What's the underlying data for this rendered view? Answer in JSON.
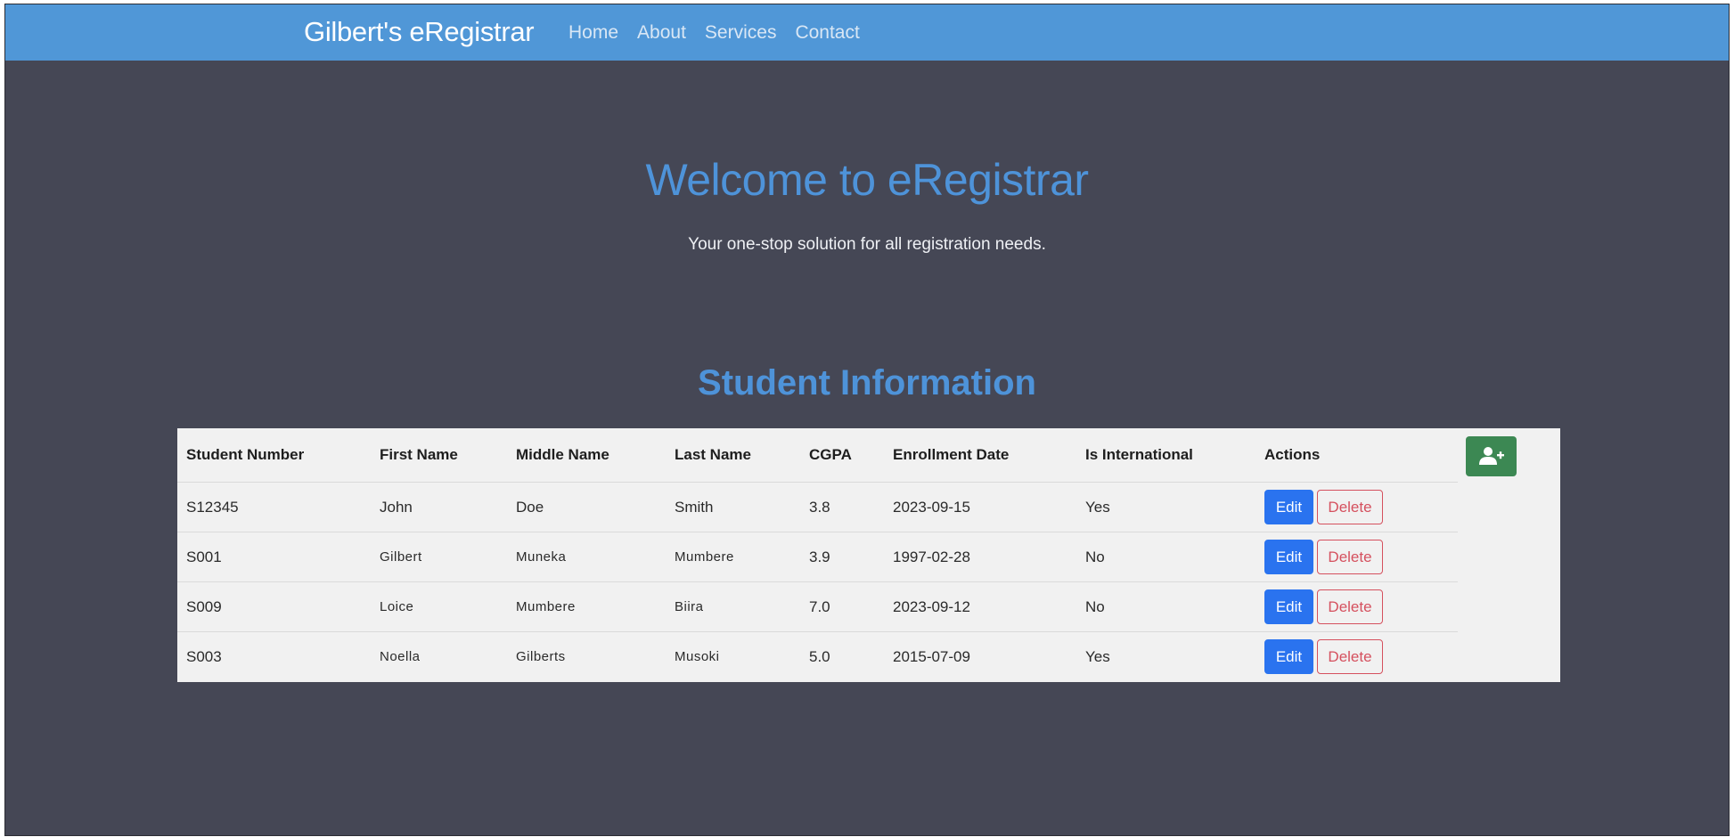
{
  "navbar": {
    "brand": "Gilbert's eRegistrar",
    "links": [
      {
        "label": "Home"
      },
      {
        "label": "About"
      },
      {
        "label": "Services"
      },
      {
        "label": "Contact"
      }
    ]
  },
  "hero": {
    "title": "Welcome to eRegistrar",
    "subtitle": "Your one-stop solution for all registration needs."
  },
  "students": {
    "section_title": "Student Information",
    "columns": [
      "Student Number",
      "First Name",
      "Middle Name",
      "Last Name",
      "CGPA",
      "Enrollment Date",
      "Is International",
      "Actions"
    ],
    "add_button_icon": "user-plus-icon",
    "rows": [
      {
        "number": "S12345",
        "first": "John",
        "middle": "Doe",
        "last": "Smith",
        "cgpa": "3.8",
        "date": "2023-09-15",
        "intl": "Yes"
      },
      {
        "number": "S001",
        "first": "Gilbert",
        "middle": "Muneka",
        "last": "Mumbere",
        "cgpa": "3.9",
        "date": "1997-02-28",
        "intl": "No"
      },
      {
        "number": "S009",
        "first": "Loice",
        "middle": "Mumbere",
        "last": "Biira",
        "cgpa": "7.0",
        "date": "2023-09-12",
        "intl": "No"
      },
      {
        "number": "S003",
        "first": "Noella",
        "middle": "Gilberts",
        "last": "Musoki",
        "cgpa": "5.0",
        "date": "2015-07-09",
        "intl": "Yes"
      }
    ],
    "edit_label": "Edit",
    "delete_label": "Delete"
  },
  "colors": {
    "navbar": "#5097d7",
    "background": "#454755",
    "accent": "#4e93d9",
    "edit": "#2a73ef",
    "delete": "#d5505e",
    "add": "#3c8853"
  }
}
